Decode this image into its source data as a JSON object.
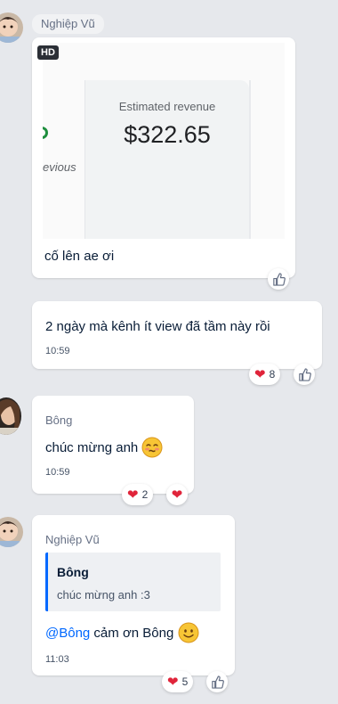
{
  "messages": [
    {
      "sender": "Nghiệp Vũ",
      "hd_badge": "HD",
      "preview": {
        "metric_label": "Estimated revenue",
        "metric_value": "$322.65",
        "left_caption": "evious"
      },
      "text": "cố lên ae ơi"
    },
    {
      "text": "2 ngày mà kênh ít view đã tầm này rồi",
      "time": "10:59",
      "reaction_count": "8"
    },
    {
      "sender": "Bông",
      "text": "chúc mừng anh",
      "time": "10:59",
      "reaction_count": "2"
    },
    {
      "sender": "Nghiệp Vũ",
      "quote": {
        "author": "Bông",
        "text": "chúc mừng anh :3"
      },
      "mention": "@Bông",
      "text": " cảm ơn Bông",
      "time": "11:03",
      "reaction_count": "5"
    }
  ],
  "colors": {
    "background": "#e6e8ec",
    "bubble": "#ffffff",
    "mention": "#0068ff",
    "quote_bar": "#0068ff",
    "heart": "#e0243a"
  },
  "icons": [
    "like-icon",
    "heart-icon",
    "blush-emoji-icon",
    "smile-emoji-icon"
  ]
}
